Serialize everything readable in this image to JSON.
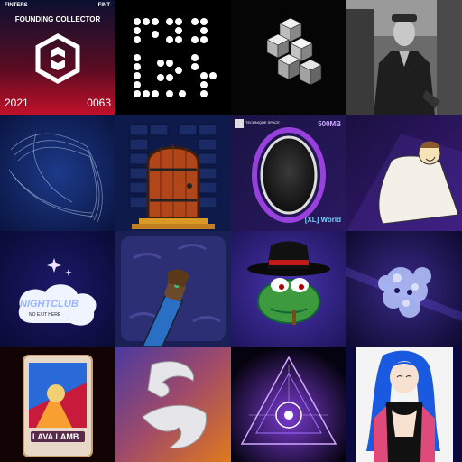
{
  "tiles": [
    {
      "name": "founding-collector",
      "brand_left": "FINTERS",
      "brand_right": "FINT",
      "title": "FOUNDING COLLECTOR",
      "year": "2021",
      "number": "0063"
    },
    {
      "name": "dot-matrix-glyphs"
    },
    {
      "name": "white-cubes"
    },
    {
      "name": "bw-street-photo"
    },
    {
      "name": "translucent-ribbon"
    },
    {
      "name": "wooden-door"
    },
    {
      "name": "mirror-portal",
      "tag_left": "TECHNIQUE SPACE",
      "size_label": "500MB",
      "footer": "[XL] World"
    },
    {
      "name": "sketch-figure"
    },
    {
      "name": "nightclub-moon",
      "sign": "NIGHTCLUB",
      "subsign": "NO EXIT HERE"
    },
    {
      "name": "fist-arm"
    },
    {
      "name": "frog-fedora"
    },
    {
      "name": "crystal-skull"
    },
    {
      "name": "lava-lamb-card",
      "title": "LAVA LAMB"
    },
    {
      "name": "white-claws"
    },
    {
      "name": "cosmic-triangle"
    },
    {
      "name": "anime-girl-blue-hair"
    }
  ],
  "colors": {
    "founding_red": "#c4102a",
    "founding_navy": "#0b1030",
    "purple_bg": "#3b2a8a"
  }
}
